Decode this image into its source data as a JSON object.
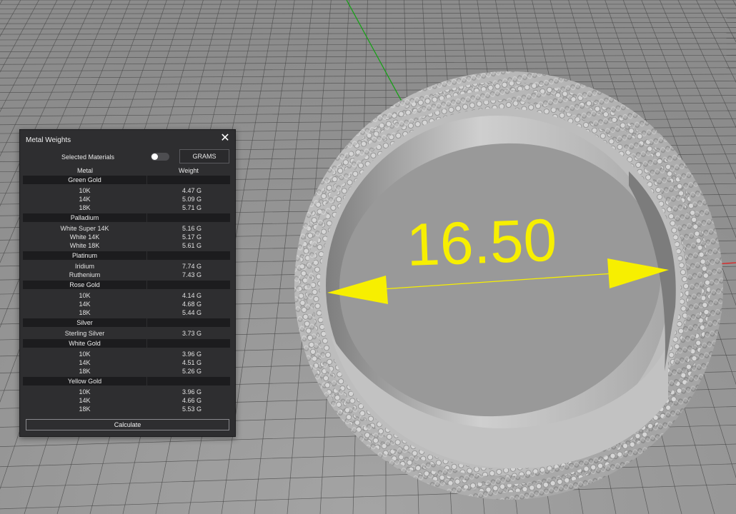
{
  "viewport": {
    "dimension_label": "16.50",
    "colors": {
      "dimension": "#f7ef00",
      "axis_x": "#e02020",
      "axis_y": "#18a018",
      "grid_line": "#4a4a4a",
      "floor": "#9a9a9a"
    }
  },
  "panel": {
    "title": "Metal Weights",
    "close_icon": "close-icon",
    "selected_materials_label": "Selected Materials",
    "units_button_label": "GRAMS",
    "column_metal": "Metal",
    "column_weight": "Weight",
    "groups": [
      {
        "name": "Green Gold",
        "items": [
          {
            "metal": "10K",
            "weight": "4.47 G"
          },
          {
            "metal": "14K",
            "weight": "5.09 G"
          },
          {
            "metal": "18K",
            "weight": "5.71 G"
          }
        ]
      },
      {
        "name": "Palladium",
        "items": [
          {
            "metal": "White Super 14K",
            "weight": "5.16 G"
          },
          {
            "metal": "White 14K",
            "weight": "5.17 G"
          },
          {
            "metal": "White 18K",
            "weight": "5.61 G"
          }
        ]
      },
      {
        "name": "Platinum",
        "items": [
          {
            "metal": "Iridium",
            "weight": "7.74 G"
          },
          {
            "metal": "Ruthenium",
            "weight": "7.43 G"
          }
        ]
      },
      {
        "name": "Rose Gold",
        "items": [
          {
            "metal": "10K",
            "weight": "4.14 G"
          },
          {
            "metal": "14K",
            "weight": "4.68 G"
          },
          {
            "metal": "18K",
            "weight": "5.44 G"
          }
        ]
      },
      {
        "name": "Silver",
        "items": [
          {
            "metal": "Sterling Silver",
            "weight": "3.73 G"
          }
        ]
      },
      {
        "name": "White Gold",
        "items": [
          {
            "metal": "10K",
            "weight": "3.96 G"
          },
          {
            "metal": "14K",
            "weight": "4.51 G"
          },
          {
            "metal": "18K",
            "weight": "5.26 G"
          }
        ]
      },
      {
        "name": "Yellow Gold",
        "items": [
          {
            "metal": "10K",
            "weight": "3.96 G"
          },
          {
            "metal": "14K",
            "weight": "4.66 G"
          },
          {
            "metal": "18K",
            "weight": "5.53 G"
          }
        ]
      }
    ],
    "calculate_label": "Calculate"
  }
}
